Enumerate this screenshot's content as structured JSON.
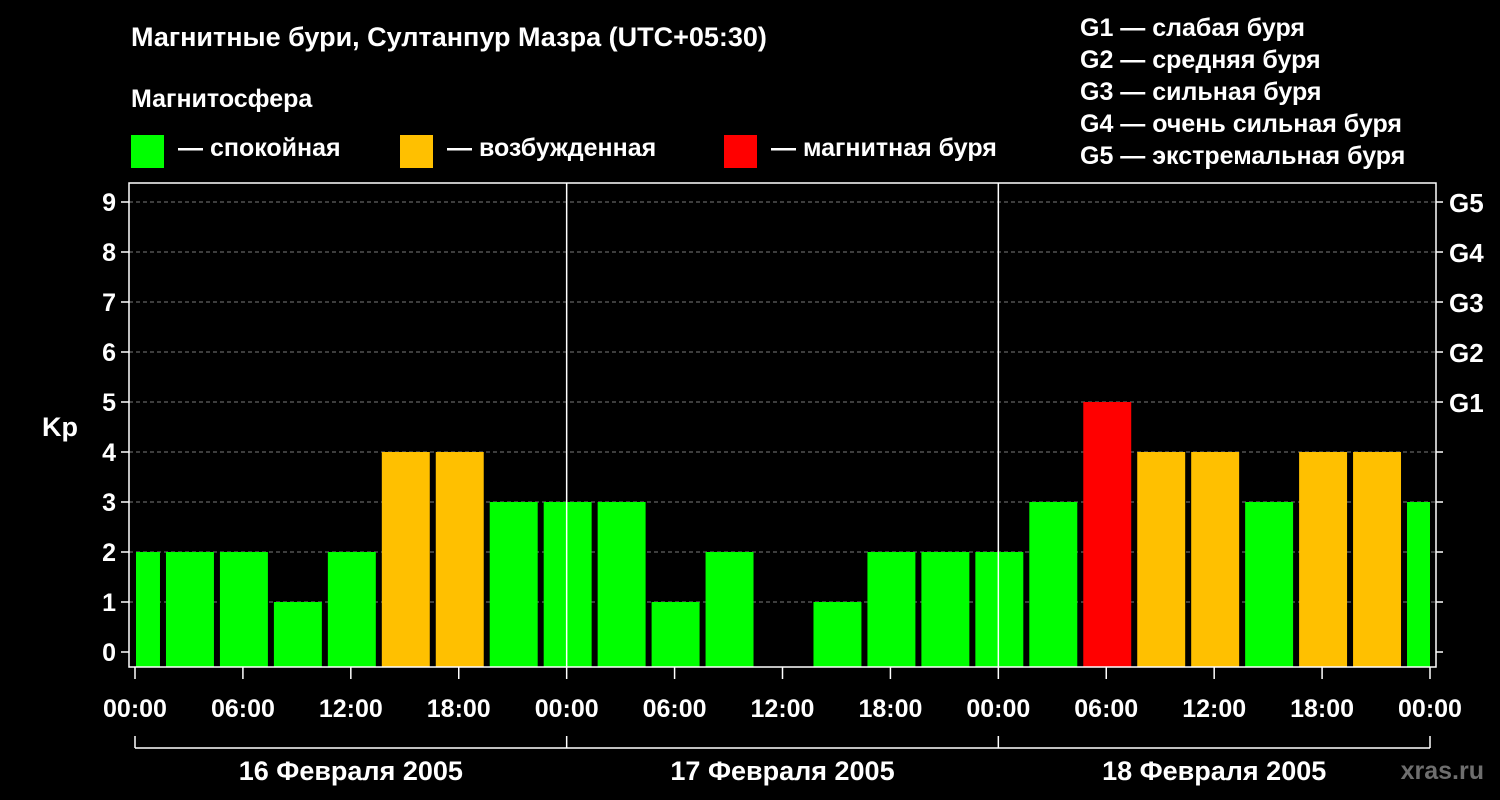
{
  "chart_data": {
    "type": "bar",
    "title": "Магнитные бури, Султанпур Мазра (UTC+05:30)",
    "subtitle": "Магнитосфера",
    "ylabel": "Kp",
    "ylim": [
      0,
      9
    ],
    "yticks": [
      "0",
      "1",
      "2",
      "3",
      "4",
      "5",
      "6",
      "7",
      "8",
      "9"
    ],
    "right_ticks": [
      {
        "value": 5,
        "label": "G1"
      },
      {
        "value": 6,
        "label": "G2"
      },
      {
        "value": 7,
        "label": "G3"
      },
      {
        "value": 8,
        "label": "G4"
      },
      {
        "value": 9,
        "label": "G5"
      }
    ],
    "xticks": [
      "00:00",
      "06:00",
      "12:00",
      "18:00",
      "00:00",
      "06:00",
      "12:00",
      "18:00",
      "00:00",
      "06:00",
      "12:00",
      "18:00",
      "00:00"
    ],
    "dates": [
      "16 Февраля 2005",
      "17 Февраля 2005",
      "18 Февраля 2005"
    ],
    "grid": true,
    "legend": [
      {
        "label": "— спокойная",
        "color": "#00ff00"
      },
      {
        "label": "— возбужденная",
        "color": "#ffc000"
      },
      {
        "label": "— магнитная буря",
        "color": "#ff0000"
      }
    ],
    "g_scale": [
      "G1 — слабая буря",
      "G2 — средняя буря",
      "G3 — сильная буря",
      "G4 — очень сильная буря",
      "G5 — экстремальная буря"
    ],
    "bars": [
      {
        "start_hour": -1.5,
        "kp": 2
      },
      {
        "start_hour": 1.5,
        "kp": 2
      },
      {
        "start_hour": 4.5,
        "kp": 2
      },
      {
        "start_hour": 7.5,
        "kp": 1
      },
      {
        "start_hour": 10.5,
        "kp": 2
      },
      {
        "start_hour": 13.5,
        "kp": 4
      },
      {
        "start_hour": 16.5,
        "kp": 4
      },
      {
        "start_hour": 19.5,
        "kp": 3
      },
      {
        "start_hour": 22.5,
        "kp": 3
      },
      {
        "start_hour": 25.5,
        "kp": 3
      },
      {
        "start_hour": 28.5,
        "kp": 1
      },
      {
        "start_hour": 31.5,
        "kp": 2
      },
      {
        "start_hour": 34.5,
        "kp": 0
      },
      {
        "start_hour": 37.5,
        "kp": 1
      },
      {
        "start_hour": 40.5,
        "kp": 2
      },
      {
        "start_hour": 43.5,
        "kp": 2
      },
      {
        "start_hour": 46.5,
        "kp": 2
      },
      {
        "start_hour": 49.5,
        "kp": 3
      },
      {
        "start_hour": 52.5,
        "kp": 5
      },
      {
        "start_hour": 55.5,
        "kp": 4
      },
      {
        "start_hour": 58.5,
        "kp": 4
      },
      {
        "start_hour": 61.5,
        "kp": 3
      },
      {
        "start_hour": 64.5,
        "kp": 4
      },
      {
        "start_hour": 67.5,
        "kp": 4
      },
      {
        "start_hour": 70.5,
        "kp": 3
      }
    ]
  },
  "watermark": "xras.ru"
}
